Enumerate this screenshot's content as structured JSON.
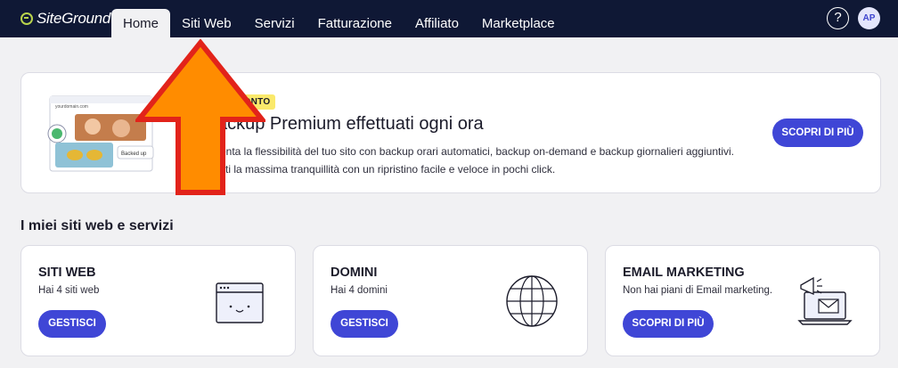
{
  "brand": {
    "name": "SiteGround"
  },
  "nav": {
    "items": [
      {
        "label": "Home",
        "active": true
      },
      {
        "label": "Siti Web"
      },
      {
        "label": "Servizi"
      },
      {
        "label": "Fatturazione"
      },
      {
        "label": "Affiliato"
      },
      {
        "label": "Marketplace"
      }
    ],
    "help_label": "?",
    "avatar_initials": "AP"
  },
  "promo": {
    "badge": "SCONTO",
    "title": "ackup Premium effettuati ogni ora",
    "desc_line1": "menta la flessibilità del tuo sito con backup orari automatici, backup on-demand e backup giornalieri aggiuntivi.",
    "desc_line2": "oditi la massima tranquillità con un ripristino facile e veloce in pochi click.",
    "button": "SCOPRI DI PIÙ",
    "illus_url": "yourdomain.com",
    "illus_tag": "Backed up"
  },
  "section": {
    "title": "I miei siti web e servizi"
  },
  "cards": [
    {
      "title": "SITI WEB",
      "subtitle": "Hai 4 siti web",
      "button": "GESTISCI",
      "icon": "browser-window-icon"
    },
    {
      "title": "DOMINI",
      "subtitle": "Hai 4 domini",
      "button": "GESTISCI",
      "icon": "globe-icon"
    },
    {
      "title": "EMAIL MARKETING",
      "subtitle": "Non hai piani di Email marketing.",
      "button": "SCOPRI DI PIÙ",
      "icon": "megaphone-laptop-icon"
    }
  ],
  "colors": {
    "nav_bg": "#0f1835",
    "accent": "#3f46d6",
    "arrow_fill": "#ff8c00",
    "arrow_border": "#e2231a",
    "badge": "#fae96b"
  }
}
